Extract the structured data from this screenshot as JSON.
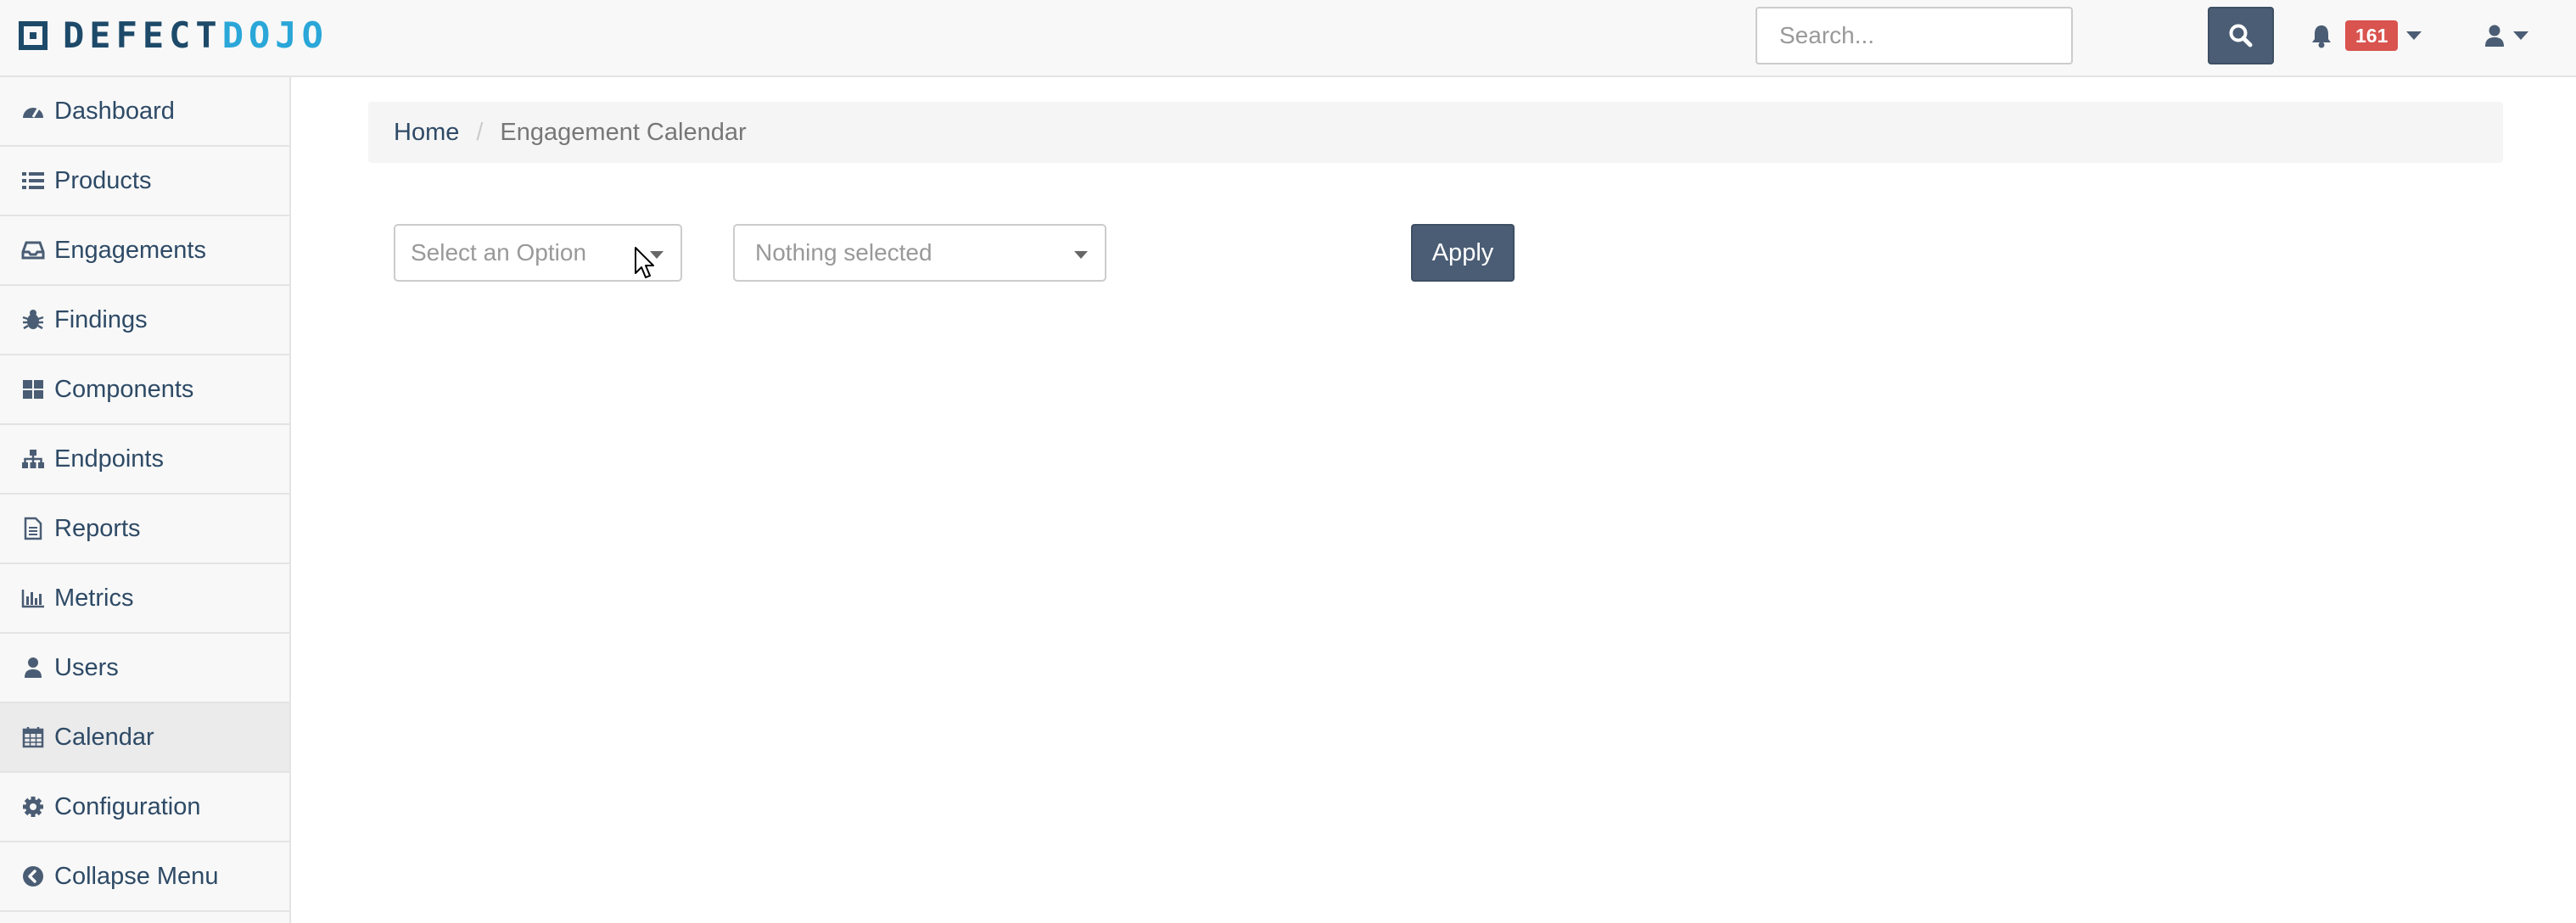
{
  "brand": {
    "part1": "DEFECT",
    "part2": "DOJO"
  },
  "header": {
    "search_placeholder": "Search...",
    "notification_count": "161",
    "icons": {
      "search": "search-icon",
      "bell": "bell-icon",
      "user": "user-icon"
    }
  },
  "sidebar": {
    "items": [
      {
        "label": "Dashboard",
        "icon": "tachometer-icon"
      },
      {
        "label": "Products",
        "icon": "list-icon"
      },
      {
        "label": "Engagements",
        "icon": "inbox-icon"
      },
      {
        "label": "Findings",
        "icon": "bug-icon"
      },
      {
        "label": "Components",
        "icon": "grid-icon"
      },
      {
        "label": "Endpoints",
        "icon": "sitemap-icon"
      },
      {
        "label": "Reports",
        "icon": "file-icon"
      },
      {
        "label": "Metrics",
        "icon": "bar-chart-icon"
      },
      {
        "label": "Users",
        "icon": "user-icon"
      },
      {
        "label": "Calendar",
        "icon": "calendar-icon",
        "active": true
      },
      {
        "label": "Configuration",
        "icon": "gear-icon"
      },
      {
        "label": "Collapse Menu",
        "icon": "arrow-circle-left-icon"
      }
    ]
  },
  "breadcrumb": {
    "home": "Home",
    "separator": "/",
    "current": "Engagement Calendar"
  },
  "filters": {
    "select1_placeholder": "Select an Option",
    "select2_placeholder": "Nothing selected",
    "apply_label": "Apply"
  },
  "colors": {
    "brand_dark": "#1e4a6a",
    "brand_light": "#2aa7d8",
    "primary_button": "#4a5d74",
    "badge": "#d9534f",
    "link": "#2e4a66"
  }
}
